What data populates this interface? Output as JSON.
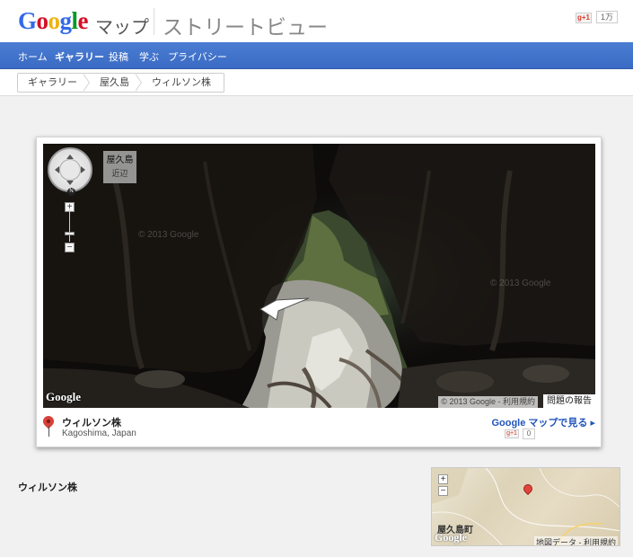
{
  "header": {
    "logo_letters": [
      "G",
      "o",
      "o",
      "g",
      "l",
      "e"
    ],
    "product": "マップ",
    "title": "ストリートビュー",
    "gplus_label": "g+1",
    "gplus_count": "1万"
  },
  "nav": {
    "items": [
      {
        "label": "ホーム"
      },
      {
        "label": "ギャラリー"
      },
      {
        "label": "投稿"
      },
      {
        "label": "学ぶ"
      },
      {
        "label": "プライバシー"
      }
    ]
  },
  "breadcrumb": [
    "ギャラリー",
    "屋久島",
    "ウィルソン株"
  ],
  "pano": {
    "watermark": "© 2013 Google",
    "place_label": "屋久島",
    "place_sub": "近辺",
    "google": "Google",
    "attribution": "© 2013 Google - 利用規約",
    "report": "問題の報告",
    "zoom_in": "+",
    "zoom_out": "−",
    "compass_n": "N"
  },
  "info": {
    "name": "ウィルソン株",
    "region": "Kagoshima, Japan",
    "maps_link": "Google マップで見る ▸",
    "gplus_label": "g+1",
    "gplus_count": "0"
  },
  "section_title": "ウィルソン株",
  "minimap": {
    "zoom_in": "+",
    "zoom_out": "−",
    "town": "屋久島町",
    "google": "Google",
    "attribution": "地図データ - 利用規約"
  },
  "colors": {
    "nav_blue": "#3b6bc4",
    "link_blue": "#2255bb",
    "pin_red": "#d9403a"
  }
}
